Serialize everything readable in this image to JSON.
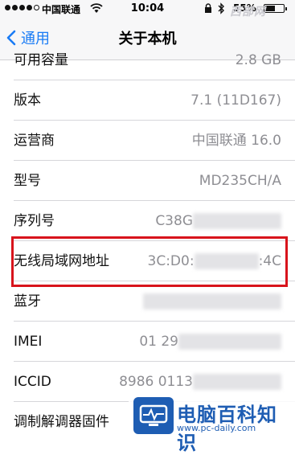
{
  "status_bar": {
    "carrier": "中国联通",
    "time": "10:04",
    "battery": "55%",
    "battery_level": 0.55
  },
  "watermark_top": "西部网",
  "nav": {
    "back_label": "通用",
    "title": "关于本机"
  },
  "rows": [
    {
      "label": "可用容量",
      "value": "2.8 GB"
    },
    {
      "label": "版本",
      "value": "7.1 (11D167)"
    },
    {
      "label": "运营商",
      "value": "中国联通 16.0"
    },
    {
      "label": "型号",
      "value": "MD235CH/A"
    },
    {
      "label": "序列号",
      "value": "C38G"
    },
    {
      "label": "无线局域网地址",
      "value_prefix": "3C:D0:",
      "value_suffix": ":4C"
    },
    {
      "label": "蓝牙",
      "value": ""
    },
    {
      "label": "IMEI",
      "value": "01 29"
    },
    {
      "label": "ICCID",
      "value": "8986 0113"
    },
    {
      "label": "调制解调器固件",
      "value": ""
    }
  ],
  "watermark_logo": {
    "name": "电脑百科知识",
    "url": "www.pc-daily.com"
  },
  "colors": {
    "accent": "#1a7cf5",
    "highlight": "#d8141c",
    "value_text": "#8e8e93",
    "logo": "#1e5db3"
  }
}
